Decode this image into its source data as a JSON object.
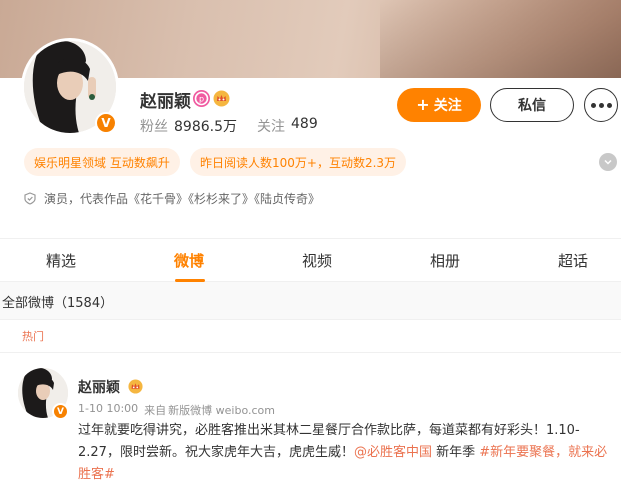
{
  "profile": {
    "name": "赵丽颖",
    "fans_label": "粉丝",
    "fans_value": "8986.5万",
    "following_label": "关注",
    "following_value": "489",
    "verified_badge": "V",
    "follow_label": "关注",
    "message_label": "私信",
    "tags": [
      "娱乐明星领域 互动数飙升",
      "昨日阅读人数100万+，互动数2.3万"
    ],
    "description": "演员，代表作品《花千骨》《杉杉来了》《陆贞传奇》"
  },
  "tabs": [
    {
      "label": "精选",
      "active": false
    },
    {
      "label": "微博",
      "active": true
    },
    {
      "label": "视频",
      "active": false
    },
    {
      "label": "相册",
      "active": false
    },
    {
      "label": "超话",
      "active": false
    }
  ],
  "feed": {
    "all_label": "全部微博（1584）",
    "hot_label": "热门",
    "post": {
      "author": "赵丽颖",
      "time": "1-10 10:00",
      "source_prefix": "来自",
      "source": "新版微博 weibo.com",
      "text_main": "过年就要吃得讲究，必胜客推出米其林二星餐厅合作款比萨，每道菜都有好彩头！1.10-2.27，限时尝新。祝大家虎年大吉，虎虎生威！",
      "mention": "@必胜客中国",
      "text_mid": " 新年季 ",
      "hashtag": "#新年要聚餐，就来必胜客#"
    }
  },
  "colors": {
    "accent": "#ff8200",
    "link": "#eb7350",
    "tag_bg": "#fff1e6",
    "muted": "#939393"
  },
  "icons": {
    "verified": "verified-v-icon",
    "ip_badge": "p-badge-icon",
    "crown": "vip-crown-icon",
    "plus": "plus-icon",
    "more": "more-dots-icon",
    "expand": "chevron-down-icon",
    "shield": "shield-icon"
  }
}
